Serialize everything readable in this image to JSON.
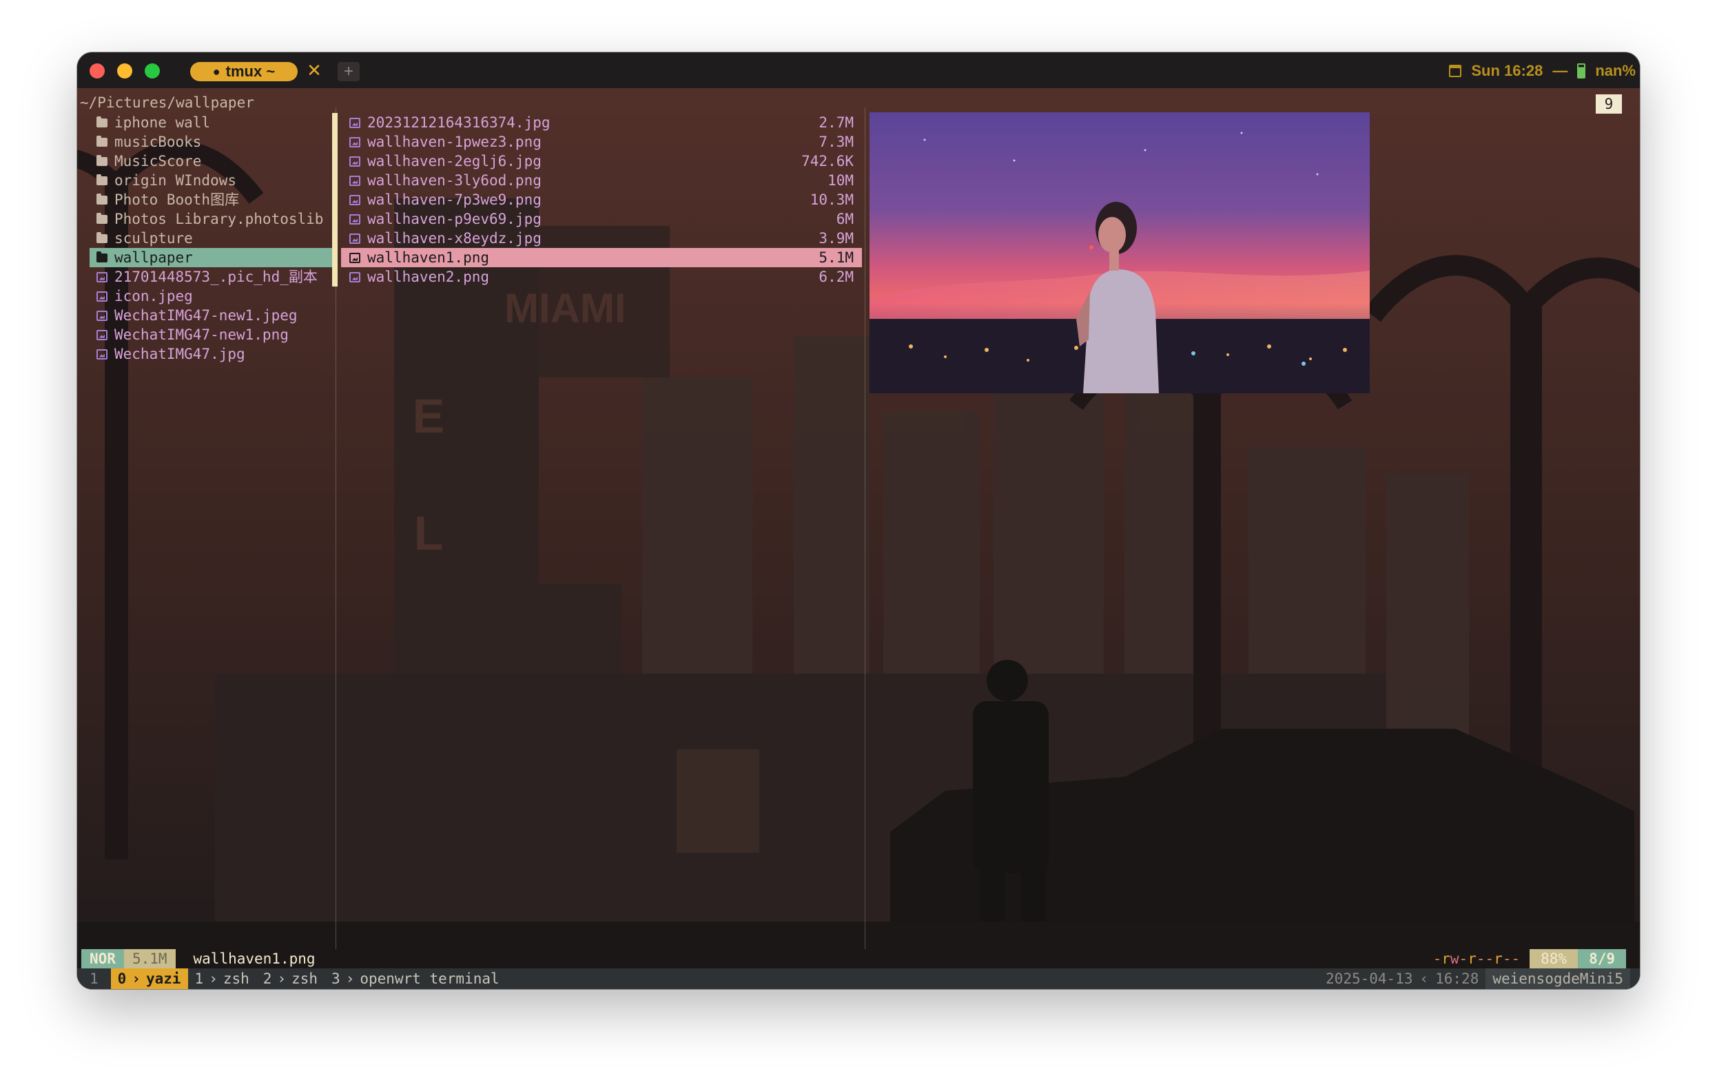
{
  "titlebar": {
    "tab_label": "tmux ~",
    "tab_close": "✕",
    "new_tab": "+",
    "clock": "Sun 16:28",
    "battery_sep": "—",
    "battery": "nan%"
  },
  "yazi": {
    "cwd": "~/Pictures/wallpaper",
    "count_badge": "9",
    "parent_items": [
      {
        "label": "iphone wall",
        "kind": "dir"
      },
      {
        "label": "musicBooks",
        "kind": "dir"
      },
      {
        "label": "MusicScore",
        "kind": "dir"
      },
      {
        "label": "origin WIndows",
        "kind": "dir"
      },
      {
        "label": "Photo Booth图库",
        "kind": "dir"
      },
      {
        "label": "Photos Library.photoslib",
        "kind": "dir"
      },
      {
        "label": "sculpture",
        "kind": "dir"
      },
      {
        "label": "wallpaper",
        "kind": "dir",
        "selected": true
      },
      {
        "label": "21701448573_.pic_hd_副本",
        "kind": "file"
      },
      {
        "label": "icon.jpeg",
        "kind": "file"
      },
      {
        "label": "WechatIMG47-new1.jpeg",
        "kind": "file"
      },
      {
        "label": "WechatIMG47-new1.png",
        "kind": "file"
      },
      {
        "label": "WechatIMG47.jpg",
        "kind": "file"
      }
    ],
    "files": [
      {
        "name": "20231212164316374.jpg",
        "size": "2.7M"
      },
      {
        "name": "wallhaven-1pwez3.png",
        "size": "7.3M"
      },
      {
        "name": "wallhaven-2eglj6.jpg",
        "size": "742.6K"
      },
      {
        "name": "wallhaven-3ly6od.png",
        "size": "10M"
      },
      {
        "name": "wallhaven-7p3we9.png",
        "size": "10.3M"
      },
      {
        "name": "wallhaven-p9ev69.jpg",
        "size": "6M"
      },
      {
        "name": "wallhaven-x8eydz.jpg",
        "size": "3.9M"
      },
      {
        "name": "wallhaven1.png",
        "size": "5.1M",
        "selected": true
      },
      {
        "name": "wallhaven2.png",
        "size": "6.2M"
      }
    ],
    "status": {
      "mode": "NOR",
      "size": "5.1M",
      "filename": "wallhaven1.png",
      "perm": [
        "-",
        "r",
        "w",
        "-",
        "r",
        "-",
        "-",
        "r",
        "-",
        "-"
      ],
      "percent": "88%",
      "position": "8/9"
    }
  },
  "tmux": {
    "session": "1",
    "windows": [
      {
        "index": "0",
        "name": "yazi",
        "active": true
      },
      {
        "index": "1",
        "name": "zsh"
      },
      {
        "index": "2",
        "name": "zsh"
      },
      {
        "index": "3",
        "name": "openwrt terminal"
      }
    ],
    "date": "2025-04-13",
    "time": "16:28",
    "host": "weiensogdeMini5"
  },
  "colors": {
    "accent_yellow": "#e3a82b",
    "selection_green": "#7fb39b",
    "selection_pink": "#e59aa8",
    "file_purple": "#d6a3d8"
  }
}
